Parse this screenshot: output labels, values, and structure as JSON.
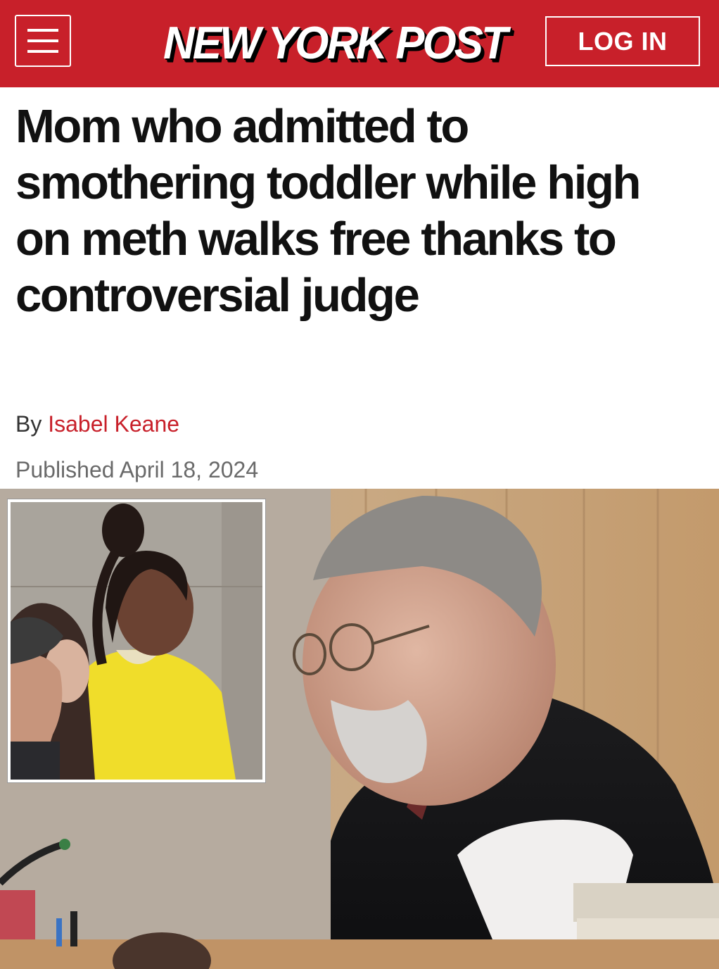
{
  "header": {
    "logo_text": "NEW YORK POST",
    "login_label": "LOG IN",
    "brand_color": "#c8202a",
    "menu_icon": "hamburger-menu-icon"
  },
  "article": {
    "headline": "Mom who admitted to smothering toddler while high on meth walks free thanks to controversial judge",
    "byline_prefix": "By",
    "author": "Isabel Keane",
    "published": "Published April 18, 2024"
  }
}
